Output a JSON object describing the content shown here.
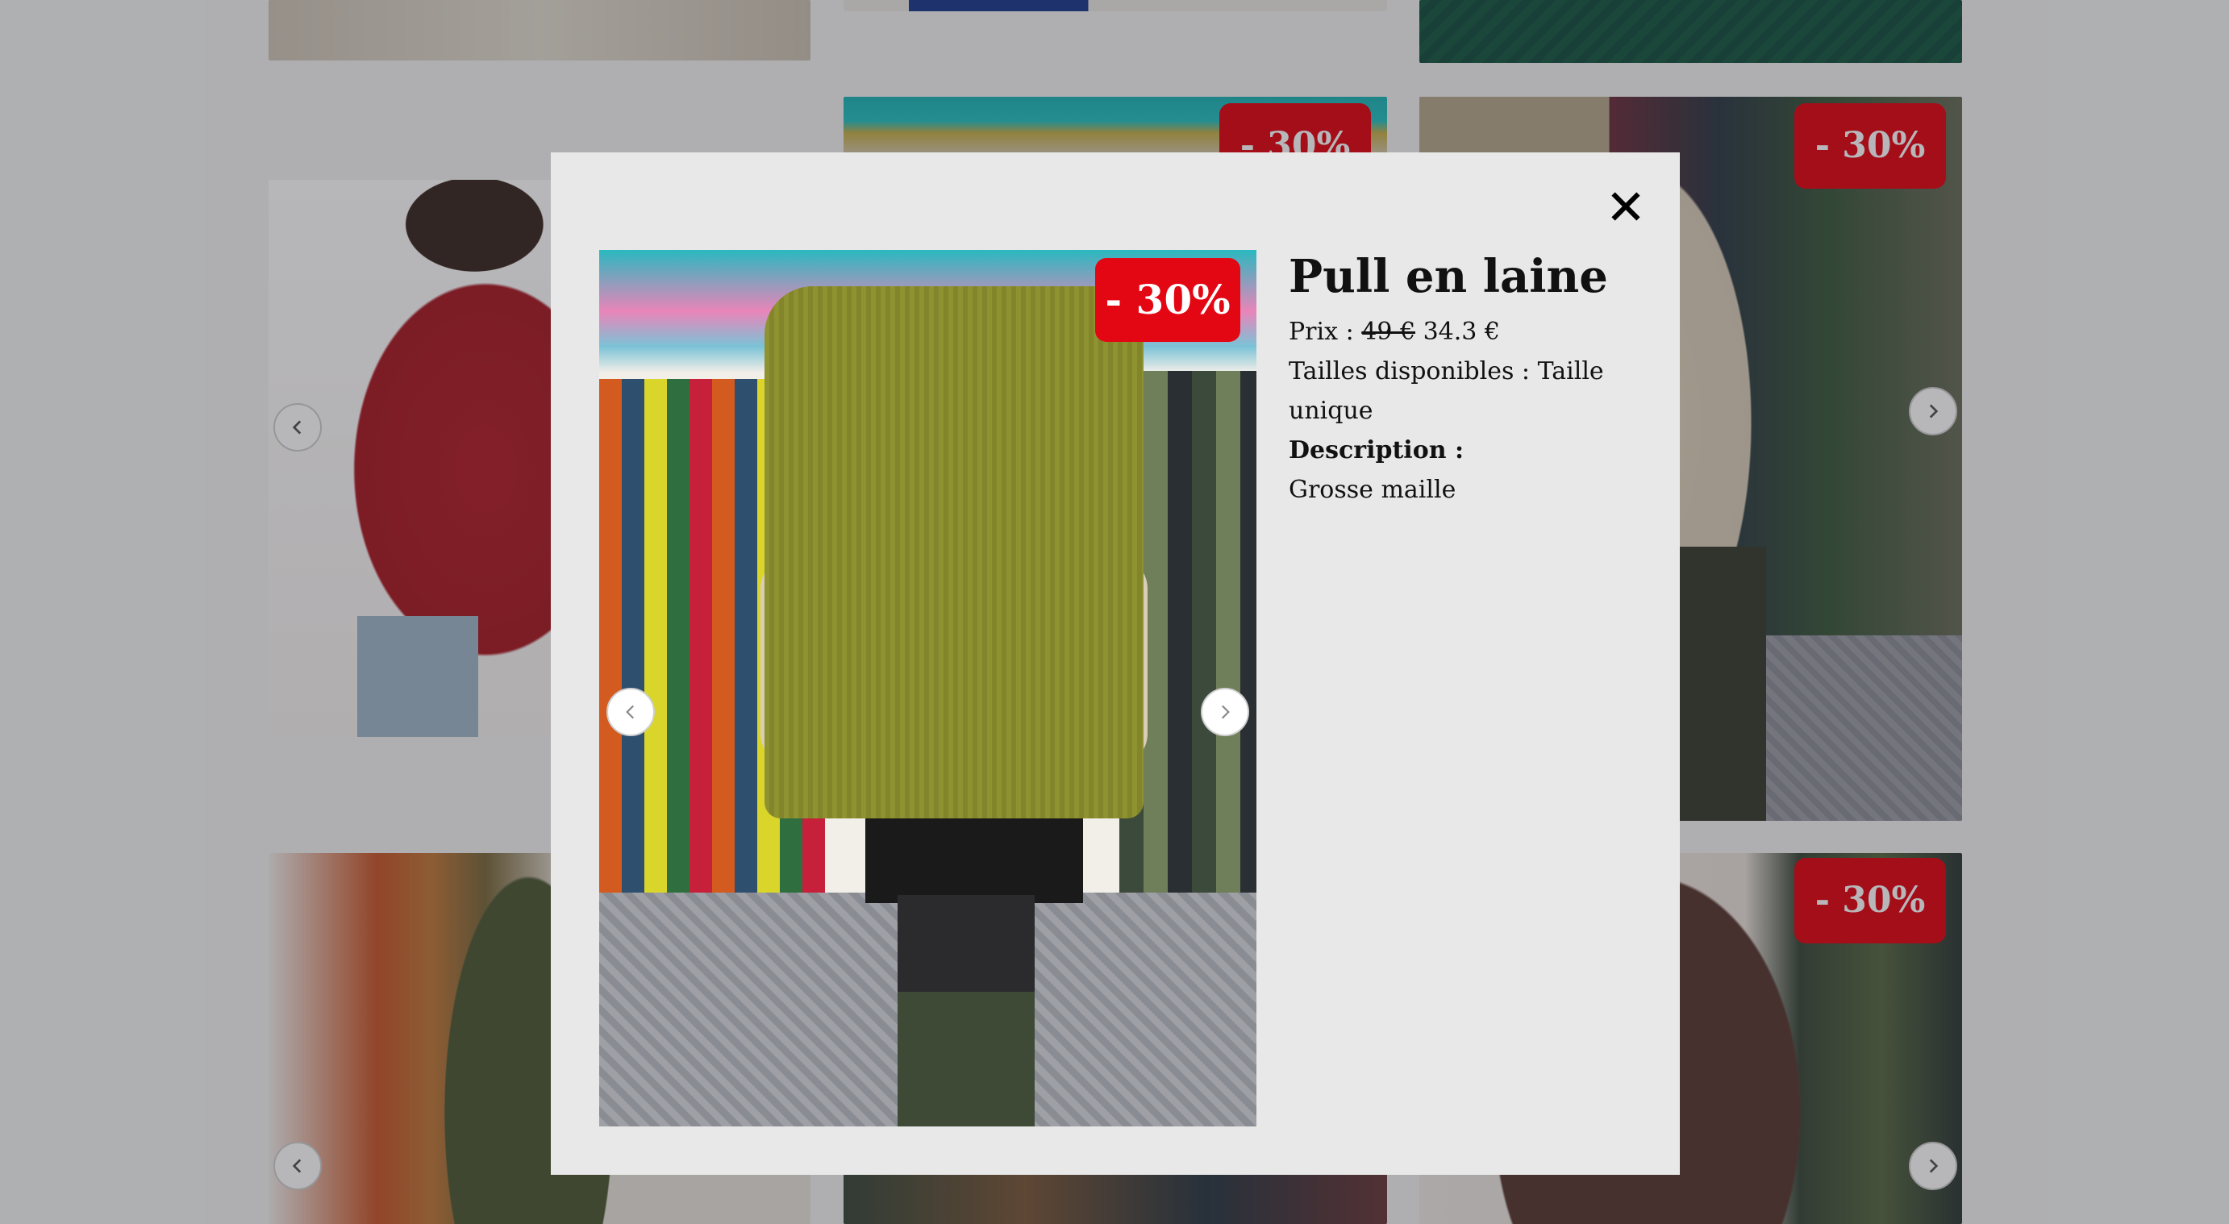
{
  "discount_badge": "- 30%",
  "modal": {
    "title": "Pull en laine",
    "price_label": "Prix :",
    "old_price": "49 €",
    "new_price": "34.3 €",
    "sizes_label": "Tailles disponibles :",
    "sizes_value": "Taille unique",
    "description_label": "Description :",
    "description_text": "Grosse maille",
    "close_icon": "close-icon",
    "prev_icon": "chevron-left-icon",
    "next_icon": "chevron-right-icon"
  },
  "colors": {
    "badge": "#e30613",
    "modal_background": "#e8e8e8",
    "overlay": "rgba(30,32,40,0.32)",
    "sweater_green": "#8a8d2a",
    "sweater_red": "#b3202a",
    "sweater_olive": "#4f5a36",
    "sweater_brown": "#5a3a32",
    "shirt_beige": "#d9cdb8"
  }
}
